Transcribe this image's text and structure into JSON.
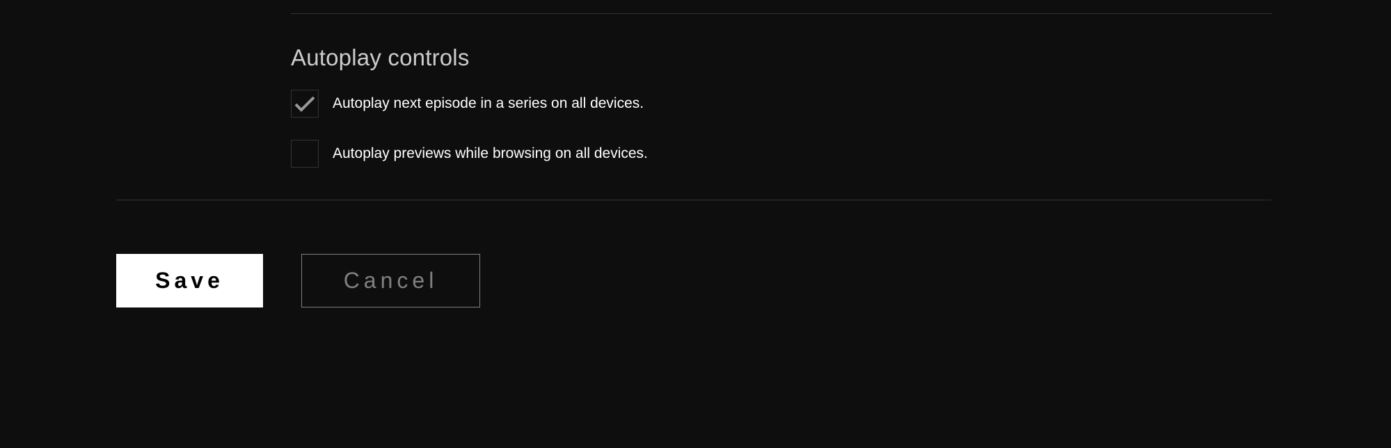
{
  "section": {
    "heading": "Autoplay controls",
    "checkboxes": [
      {
        "label": "Autoplay next episode in a series on all devices.",
        "checked": true
      },
      {
        "label": "Autoplay previews while browsing on all devices.",
        "checked": false
      }
    ]
  },
  "buttons": {
    "save_label": "Save",
    "cancel_label": "Cancel"
  }
}
